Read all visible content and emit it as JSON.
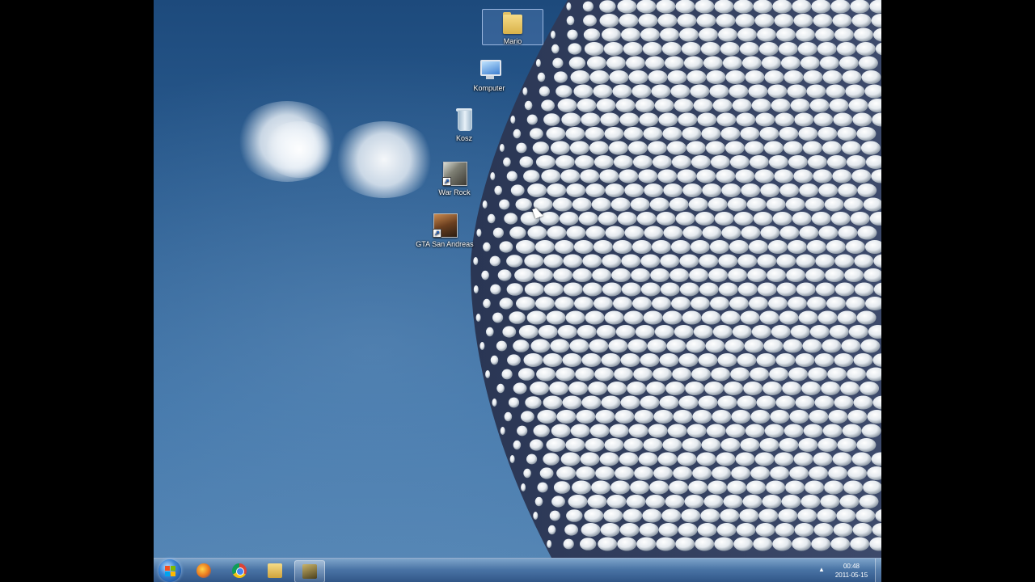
{
  "desktop": {
    "icons": [
      {
        "label": "Mario",
        "icon": "folder-icon",
        "selected": true
      },
      {
        "label": "Komputer",
        "icon": "computer-icon"
      },
      {
        "label": "Kosz",
        "icon": "recycle-bin-icon"
      },
      {
        "label": "War Rock",
        "icon": "war-rock-game-icon",
        "shortcut": true
      },
      {
        "label": "GTA San Andreas",
        "icon": "gta-san-andreas-game-icon",
        "shortcut": true
      }
    ]
  },
  "taskbar": {
    "start": "windows-start-icon",
    "pinned": [
      {
        "icon": "firefox-icon",
        "color": "#e8741c"
      },
      {
        "icon": "chrome-icon",
        "color": "#3a9b3a"
      },
      {
        "icon": "windows-explorer-icon",
        "color": "#e9c46a"
      },
      {
        "icon": "running-app-icon",
        "color": "#6b5a2a",
        "active": true
      }
    ],
    "tray_arrow": "▲",
    "clock_time": "00:48",
    "clock_date": "2011-05-15"
  },
  "colors": {
    "sky_top": "#1d4a7c",
    "sky_bottom": "#5586b5",
    "disc": "#e9eef3",
    "taskbar": "#2c4f7f"
  }
}
